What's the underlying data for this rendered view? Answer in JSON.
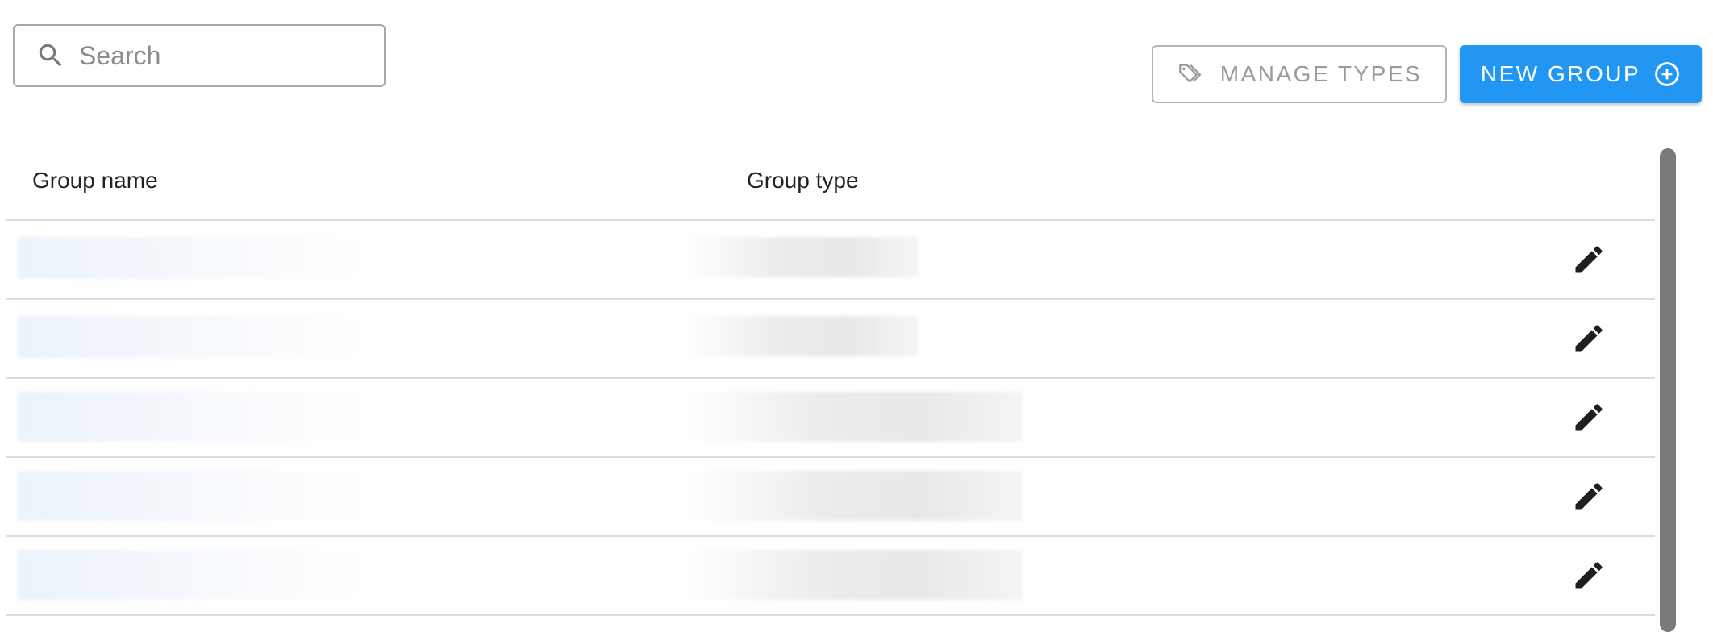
{
  "search": {
    "placeholder": "Search",
    "value": ""
  },
  "toolbar": {
    "manage_types_label": "MANAGE TYPES",
    "new_group_label": "NEW GROUP"
  },
  "table": {
    "columns": [
      "Group name",
      "Group type"
    ],
    "rows": [
      {
        "name": "",
        "type": ""
      },
      {
        "name": "",
        "type": ""
      },
      {
        "name": "",
        "type": ""
      },
      {
        "name": "",
        "type": ""
      },
      {
        "name": "",
        "type": ""
      }
    ]
  },
  "colors": {
    "primary": "#2196f3",
    "border": "#b5b5b5",
    "divider": "#dcdcdc",
    "scrollbar": "#7a7a7a"
  },
  "icons": {
    "search": "search-icon",
    "manage_types": "tag-icon",
    "new_group": "add-circle-icon",
    "row_action": "edit-pencil-icon"
  }
}
